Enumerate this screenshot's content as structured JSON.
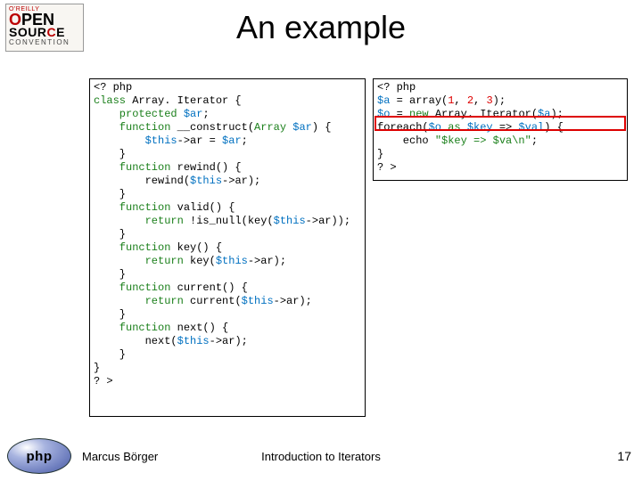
{
  "logo": {
    "line1": "O'REILLY",
    "line2a": "O",
    "line2b": "PEN",
    "line3a": "SOUR",
    "line3b": "C",
    "line3c": "E",
    "line4": "CONVENTION"
  },
  "title": "An example",
  "code_left": {
    "l1": "<? php",
    "l2a": "class",
    "l2b": " Array. Iterator {",
    "l3a": "    protected",
    "l3b": " $ar",
    "l3c": ";",
    "l4a": "    function",
    "l4b": " __construct(",
    "l4c": "Array",
    "l4d": " $ar",
    "l4e": ") {",
    "l5a": "        $this",
    "l5b": "->ar = ",
    "l5c": "$ar",
    "l5d": ";",
    "l6": "    }",
    "l7a": "    function",
    "l7b": " rewind() {",
    "l8a": "        rewind(",
    "l8b": "$this",
    "l8c": "->ar);",
    "l9": "    }",
    "l10a": "    function",
    "l10b": " valid() {",
    "l11a": "        return",
    "l11b": " !is_null(key(",
    "l11c": "$this",
    "l11d": "->ar));",
    "l12": "    }",
    "l13a": "    function",
    "l13b": " key() {",
    "l14a": "        return",
    "l14b": " key(",
    "l14c": "$this",
    "l14d": "->ar);",
    "l15": "    }",
    "l16a": "    function",
    "l16b": " current() {",
    "l17a": "        return",
    "l17b": " current(",
    "l17c": "$this",
    "l17d": "->ar);",
    "l18": "    }",
    "l19a": "    function",
    "l19b": " next() {",
    "l20a": "        next(",
    "l20b": "$this",
    "l20c": "->ar);",
    "l21": "    }",
    "l22": "}",
    "l23": "? >"
  },
  "code_right": {
    "r1": "<? php",
    "r2a": "$a",
    "r2b": " = array(",
    "r2c": "1",
    "r2d": ", ",
    "r2e": "2",
    "r2f": ", ",
    "r2g": "3",
    "r2h": ");",
    "r3a": "$o",
    "r3b": " = ",
    "r3c": "new",
    "r3d": " Array. Iterator(",
    "r3e": "$a",
    "r3f": ");",
    "r4a": "foreach(",
    "r4b": "$o",
    "r4c": " as ",
    "r4d": "$key",
    "r4e": " => ",
    "r4f": "$val",
    "r4g": ") {",
    "r5a": "    echo ",
    "r5b": "\"$key => $va\\n\"",
    "r5c": ";",
    "r6": "}",
    "r7": "? >"
  },
  "footer": {
    "author": "Marcus Börger",
    "subtitle": "Introduction to Iterators",
    "page": "17",
    "php": "php"
  }
}
